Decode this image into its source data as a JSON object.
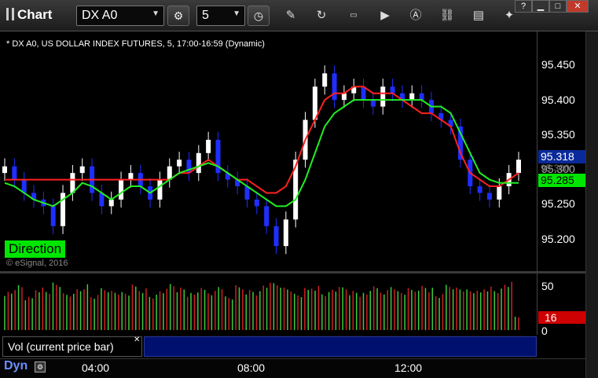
{
  "app": {
    "title": "Chart",
    "symbol_value": "DX A0",
    "interval_value": "5",
    "help": "?"
  },
  "icons": {
    "settings": "gear-icon",
    "clock": "clock-icon",
    "pencil": "pencil-icon",
    "refresh": "refresh-icon",
    "quote": "get-quote-icon",
    "play": "play-icon",
    "alert": "alert-icon",
    "link": "link-icon",
    "chat": "chat-icon",
    "twitter": "twitter-icon"
  },
  "chart": {
    "description": "* DX A0, US DOLLAR INDEX FUTURES, 5, 17:00-16:59 (Dynamic)",
    "direction_label": "Direction",
    "copyright": "© eSignal, 2016",
    "price_ticks": [
      "95.450",
      "95.400",
      "95.350",
      "95.300",
      "95.250",
      "95.200"
    ],
    "price_tag_last": "95.318",
    "price_tag_green": "95.285",
    "price_tag_hidden": "95.300",
    "volume_ticks": [
      "50",
      "0"
    ],
    "volume_tag": "16",
    "volume_legend": "Vol (current price bar)",
    "time_ticks": [
      "04:00",
      "08:00",
      "12:00"
    ],
    "dyn_label": "Dyn",
    "colors": {
      "up_candle": "#ffffff",
      "down_candle": "#1f2fff",
      "red_line": "#ff2020",
      "green_line": "#22ee22",
      "vol_up": "#3ccc3c",
      "vol_down": "#d02020"
    }
  },
  "chart_data": {
    "type": "line",
    "ylim": [
      95.17,
      95.48
    ],
    "x": [
      "04:00",
      "08:00",
      "12:00"
    ],
    "series": [
      {
        "values": [
          95.31,
          95.29,
          95.27,
          95.26,
          95.25,
          95.22,
          95.27,
          95.3,
          95.31,
          95.27,
          95.25,
          95.26,
          95.29,
          95.3,
          95.28,
          95.26,
          95.29,
          95.31,
          95.32,
          95.3,
          95.33,
          95.35,
          95.3,
          95.29,
          95.28,
          95.26,
          95.25,
          95.22,
          95.19,
          95.23,
          95.32,
          95.38,
          95.43,
          95.45,
          95.41,
          95.42,
          95.43,
          95.41,
          95.4,
          95.43,
          95.42,
          95.41,
          95.42,
          95.41,
          95.39,
          95.38,
          95.37,
          95.32,
          95.28,
          95.27,
          95.26,
          95.28,
          95.3,
          95.32
        ]
      },
      {
        "values": [
          95.29,
          95.29,
          95.29,
          95.29,
          95.29,
          95.29,
          95.29,
          95.29,
          95.29,
          95.29,
          95.29,
          95.29,
          95.29,
          95.29,
          95.29,
          95.29,
          95.29,
          95.29,
          95.3,
          95.3,
          95.31,
          95.32,
          95.31,
          95.3,
          95.29,
          95.29,
          95.28,
          95.27,
          95.27,
          95.28,
          95.31,
          95.35,
          95.38,
          95.41,
          95.42,
          95.42,
          95.43,
          95.43,
          95.42,
          95.42,
          95.42,
          95.41,
          95.4,
          95.39,
          95.39,
          95.38,
          95.37,
          95.33,
          95.3,
          95.29,
          95.28,
          95.28,
          95.29,
          95.3
        ]
      },
      {
        "values": [
          95.285,
          95.28,
          95.27,
          95.26,
          95.255,
          95.25,
          95.26,
          95.27,
          95.285,
          95.28,
          95.27,
          95.26,
          95.27,
          95.28,
          95.28,
          95.27,
          95.28,
          95.29,
          95.3,
          95.305,
          95.31,
          95.315,
          95.31,
          95.3,
          95.29,
          95.28,
          95.27,
          95.26,
          95.25,
          95.25,
          95.26,
          95.29,
          95.33,
          95.37,
          95.39,
          95.4,
          95.41,
          95.41,
          95.41,
          95.41,
          95.41,
          95.41,
          95.41,
          95.41,
          95.4,
          95.4,
          95.39,
          95.36,
          95.33,
          95.3,
          95.29,
          95.285,
          95.285,
          95.285
        ]
      }
    ],
    "volume": {
      "ylim": [
        0,
        60
      ],
      "values": [
        45,
        52,
        38,
        50,
        47,
        55,
        42,
        48,
        53,
        40,
        50,
        46,
        44,
        52,
        49,
        41,
        47,
        55,
        50,
        43,
        48,
        46,
        53,
        39,
        51,
        47,
        45,
        54,
        56,
        50,
        42,
        48,
        52,
        44,
        49,
        51,
        46,
        43,
        50,
        47,
        53,
        45,
        48,
        52,
        49,
        41,
        54,
        50,
        47,
        45,
        51,
        48,
        55,
        16
      ]
    }
  }
}
